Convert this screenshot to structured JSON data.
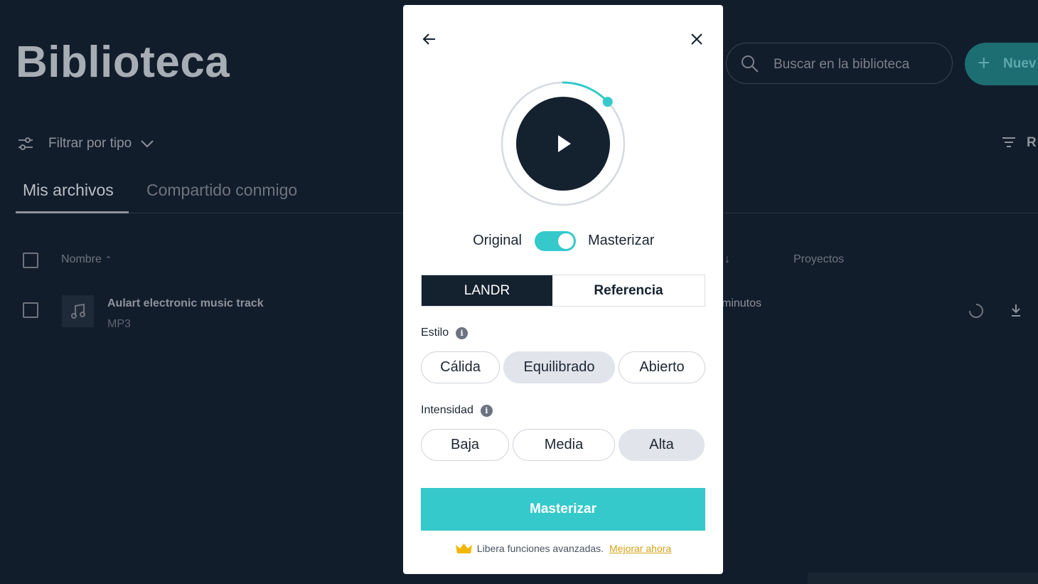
{
  "library": {
    "title": "Biblioteca",
    "search_placeholder": "Buscar en la biblioteca",
    "new_button_label": "Nuev",
    "filter_label": "Filtrar por tipo",
    "sort_label": "R",
    "tabs": [
      "Mis archivos",
      "Compartido conmigo"
    ],
    "columns": {
      "name": "Nombre",
      "projects": "Proyectos"
    },
    "rows": [
      {
        "name": "Aulart electronic music track",
        "type": "MP3",
        "date": "minutos"
      }
    ]
  },
  "modal": {
    "player": {
      "progress": 0.13
    },
    "toggle": {
      "left_label": "Original",
      "right_label": "Masterizar",
      "on": true
    },
    "engine_tabs": [
      {
        "label": "LANDR",
        "selected": true
      },
      {
        "label": "Referencia",
        "selected": false
      }
    ],
    "style": {
      "label": "Estilo",
      "options": [
        {
          "label": "Cálida",
          "selected": false
        },
        {
          "label": "Equilibrado",
          "selected": true
        },
        {
          "label": "Abierto",
          "selected": false
        }
      ]
    },
    "intensity": {
      "label": "Intensidad",
      "options": [
        {
          "label": "Baja",
          "selected": false
        },
        {
          "label": "Media",
          "selected": false
        },
        {
          "label": "Alta",
          "selected": true
        }
      ]
    },
    "cta_label": "Masterizar",
    "upsell_text": "Libera funciones avanzadas.",
    "upsell_link": "Mejorar ahora"
  },
  "colors": {
    "accent": "#35c9cb",
    "dark": "#14212f",
    "upsell_link": "#d4a216"
  }
}
